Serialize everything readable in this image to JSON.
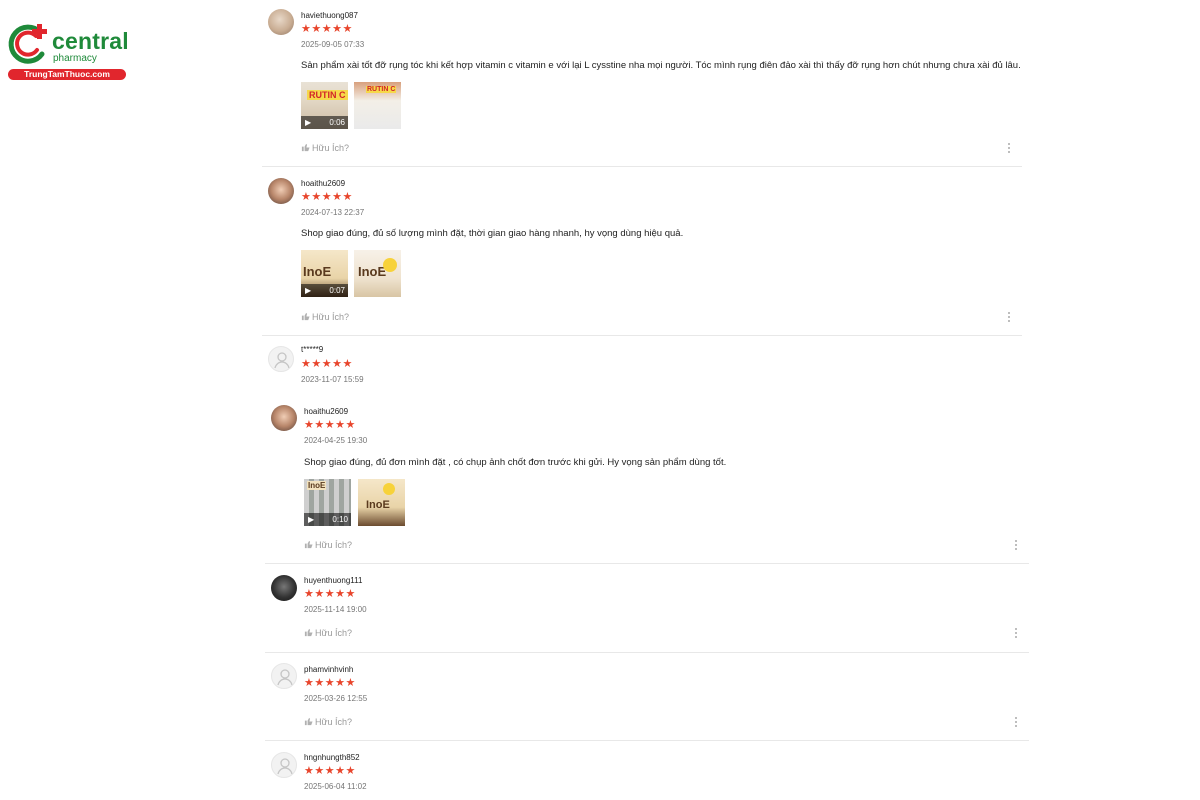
{
  "logo": {
    "brand": "central",
    "sub": "pharmacy",
    "banner": "TrungTamThuoc.com",
    "colors": {
      "green": "#1f8a3a",
      "red": "#e1262d"
    }
  },
  "star_color": "#e8452c",
  "helpful_label": "Hữu Ích?",
  "reviews": [
    {
      "username": "haviethuong087",
      "stars": "★★★★★",
      "rating": 5,
      "date": "2025-09-05 07:33",
      "text": "Sản phẩm xài tốt đỡ rụng tóc khi kết hợp vitamin c vitamin e với lại L cysstine nha mọi người. Tóc mình rụng điên đảo xài thì thấy đỡ rụng hơn chút nhưng chưa xài đủ lâu.",
      "media": [
        {
          "type": "video",
          "duration": "0:06",
          "label": "RUTIN C"
        },
        {
          "type": "image",
          "label": "RUTIN C"
        }
      ]
    },
    {
      "username": "hoaithu2609",
      "stars": "★★★★★",
      "rating": 5,
      "date": "2024-07-13 22:37",
      "text": "Shop giao đúng, đủ số lượng mình đặt, thời gian giao hàng nhanh, hy vọng dùng hiệu quả.",
      "media": [
        {
          "type": "video",
          "duration": "0:07",
          "label": "InoE"
        },
        {
          "type": "image",
          "label": "InoE"
        }
      ]
    },
    {
      "username": "t*****9",
      "stars": "★★★★★",
      "rating": 5,
      "date": "2023-11-07 15:59"
    },
    {
      "username": "hoaithu2609",
      "stars": "★★★★★",
      "rating": 5,
      "date": "2024-04-25 19:30",
      "text": "Shop giao đúng, đủ đơn mình đặt , có chụp ảnh chốt đơn trước khi gửi. Hy vọng sản phẩm dùng tốt.",
      "media": [
        {
          "type": "video",
          "duration": "0:10",
          "label": "InoE"
        },
        {
          "type": "image",
          "label": "InoE"
        }
      ]
    },
    {
      "username": "huyenthuong111",
      "stars": "★★★★★",
      "rating": 5,
      "date": "2025-11-14 19:00"
    },
    {
      "username": "phamvinhvinh",
      "stars": "★★★★★",
      "rating": 5,
      "date": "2025-03-26 12:55"
    },
    {
      "username": "hngnhungth852",
      "stars": "★★★★★",
      "rating": 5,
      "date": "2025-06-04 11:02"
    }
  ]
}
